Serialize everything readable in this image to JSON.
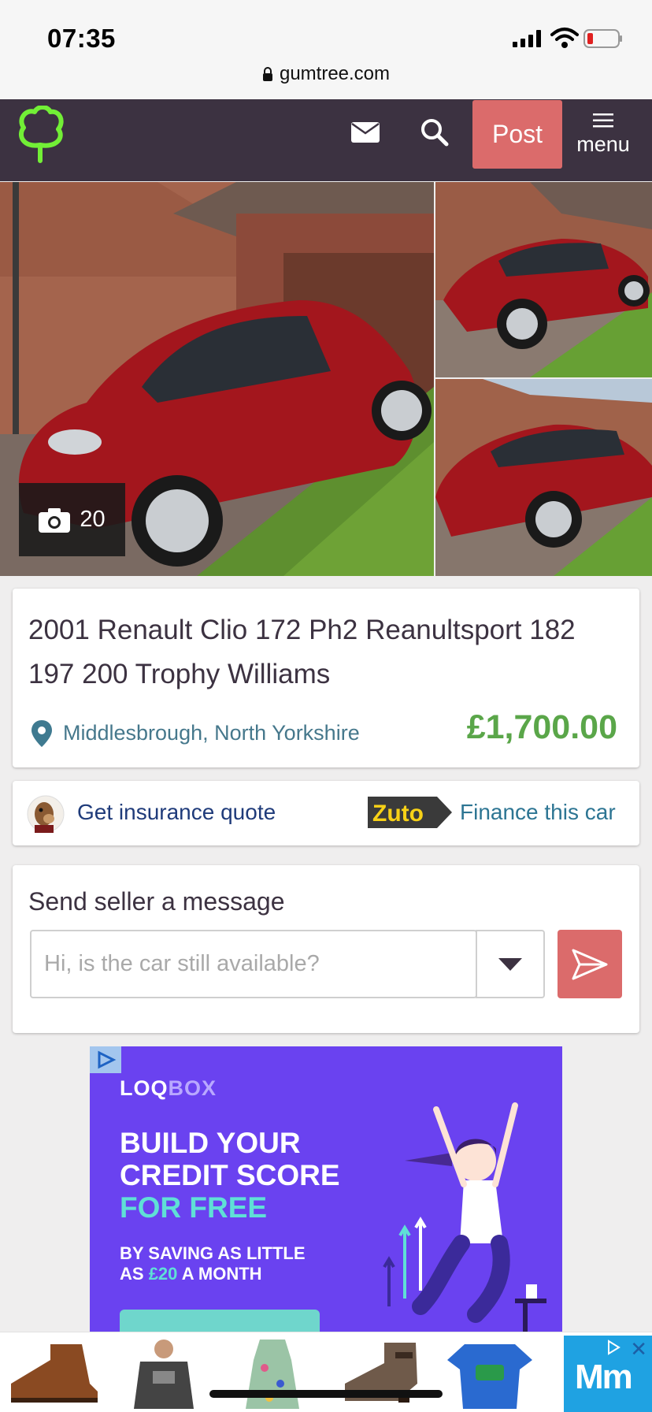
{
  "status_bar": {
    "time": "07:35",
    "url": "gumtree.com"
  },
  "header": {
    "post_label": "Post",
    "menu_label": "menu"
  },
  "gallery": {
    "photo_count": "20"
  },
  "listing": {
    "title": "2001 Renault Clio 172 Ph2 Reanultsport 182 197 200 Trophy Williams",
    "location": "Middlesbrough, North Yorkshire",
    "price": "£1,700.00"
  },
  "actions": {
    "insurance_label": "Get insurance quote",
    "zuto_brand": "Zuto",
    "finance_label": "Finance this car"
  },
  "message": {
    "title": "Send seller a message",
    "placeholder": "Hi, is the car still available?"
  },
  "ad": {
    "logo_part1": "LOQ",
    "logo_part2": "BOX",
    "headline_line1": "BUILD YOUR",
    "headline_line2": "CREDIT SCORE",
    "headline_line3": "FOR FREE",
    "sub_line1": "BY SAVING AS LITTLE",
    "sub_line2_prefix": "AS ",
    "sub_line2_amount": "£20",
    "sub_line2_suffix": " A MONTH"
  },
  "bottom_ad": {
    "brand": "Mm",
    "close": "✕"
  },
  "colors": {
    "header_bg": "#3c3241",
    "post_button": "#db6b6b",
    "price": "#5aa649",
    "logo_green": "#72ef36",
    "ad_bg": "#6a42f0"
  },
  "icons": [
    "gumtree-logo-icon",
    "mail-icon",
    "search-icon",
    "menu-icon",
    "camera-icon",
    "location-pin-icon",
    "chevron-down-icon",
    "send-icon",
    "lock-icon"
  ]
}
